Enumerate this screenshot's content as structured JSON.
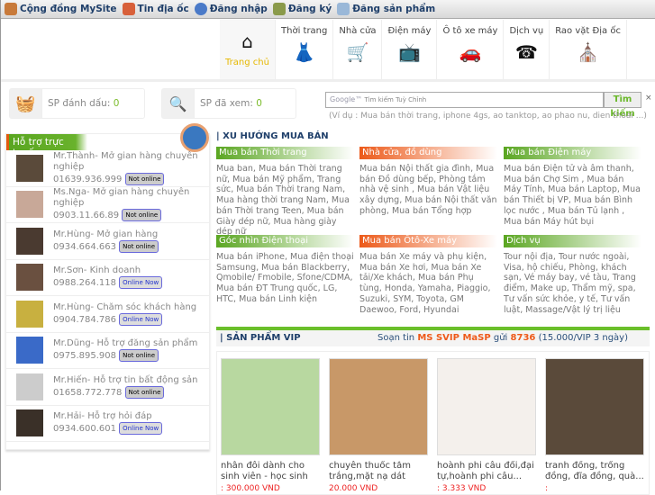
{
  "topbar": {
    "items": [
      {
        "label": "Cộng đồng MySite",
        "icon": "community-icon"
      },
      {
        "label": "Tin địa ốc",
        "icon": "house-icon"
      },
      {
        "label": "Đăng nhập",
        "icon": "login-icon"
      },
      {
        "label": "Đăng ký",
        "icon": "register-icon"
      },
      {
        "label": "Đăng sản phẩm",
        "icon": "post-product-icon"
      }
    ]
  },
  "nav": {
    "home": "Trang chủ",
    "tabs": [
      {
        "label": "Thời trang",
        "glyph": "👗"
      },
      {
        "label": "Nhà cửa",
        "glyph": "🛒"
      },
      {
        "label": "Điện máy",
        "glyph": "📺"
      },
      {
        "label": "Ô tô xe máy",
        "glyph": "🚗"
      },
      {
        "label": "Dịch vụ",
        "glyph": "☎"
      },
      {
        "label": "Rao vặt Địa ốc",
        "glyph": "⛪"
      }
    ]
  },
  "boxes": {
    "marked_label": "SP đánh dấu:",
    "marked_count": "0",
    "viewed_label": "SP đã xem:",
    "viewed_count": "0"
  },
  "support": {
    "title": "Hỗ trợ trực tuyến",
    "people": [
      {
        "name": "Mr.Thành- Mở gian hàng chuyên nghiệp",
        "phone": "01639.936.999",
        "status": "Not online"
      },
      {
        "name": "Ms.Nga- Mở gian hàng chuyên nghiệp",
        "phone": "0903.11.66.89",
        "status": "Not online"
      },
      {
        "name": "Mr.Hùng- Mở gian hàng",
        "phone": "0934.664.663",
        "status": "Not online"
      },
      {
        "name": "Mr.Sơn- Kinh doanh",
        "phone": "0988.264.118",
        "status": "Online Now"
      },
      {
        "name": "Mr.Hùng- Chăm sóc khách hàng",
        "phone": "0904.784.786",
        "status": "Online Now"
      },
      {
        "name": "Mr.Dũng- Hỗ trợ đăng sản phẩm",
        "phone": "0975.895.908",
        "status": "Not online"
      },
      {
        "name": "Mr.Hiến- Hỗ trợ tin bất động sản",
        "phone": "01658.772.778",
        "status": "Not online"
      },
      {
        "name": "Mr.Hải- Hỗ trợ hỏi đáp",
        "phone": "0934.600.601",
        "status": "Online Now"
      }
    ]
  },
  "search": {
    "brand": "Google™",
    "placeholder": "Tìm kiếm Tuỳ Chỉnh",
    "button": "Tìm kiếm",
    "close": "×",
    "hint": "(Ví dụ : Mua bán thời trang, iphone 4gs, ao tanktop, ao phao nu, dien thoai ...)"
  },
  "trends": {
    "title": "| XU HƯỚNG MUA BÁN",
    "cats": [
      {
        "title": "Mua bán Thời trang",
        "body": "Mua ban, Mua bán Thời trang nữ,  Mua bán Mỹ phẩm, Trang sức, Mua bán Thời trang Nam, Mua hàng thời trang Nam, Mua bán Thời trang Teen, Mua bán Giày dép nữ, Mua hàng giày dép nữ"
      },
      {
        "title": "Nhà cửa, đồ dùng",
        "body": "Mua bán Nội thất gia đình, Mua bán Đồ dùng bếp, Phòng tắm nhà vệ sinh , Mua bán Vật liệu xây dựng, Mua bán Nội thất văn phòng, Mua bán Tổng hợp"
      },
      {
        "title": "Mua bán Điện máy",
        "body": "Mua bán Điện tử và âm thanh, Mua bán Chợ Sim , Mua bán Máy Tính, Mua bán Laptop, Mua bán Thiết bị VP, Mua bán Bình lọc nước , Mua bán Tủ lạnh , Mua bán Máy hút bụi"
      },
      {
        "title": "Góc nhìn Điện thoại",
        "body": "Mua bán iPhone, Mua điện thoại Samsung, Mua bán Blackberry, Qmobile/ Fmobile, Sfone/CDMA, Mua bán ĐT Trung quốc, LG, HTC, Mua bán Linh kiện"
      },
      {
        "title": "Mua bán Ôtô-Xe máy",
        "body": "Mua bán Xe máy và phụ kiện, Mua bán Xe hơi, Mua bán Xe tải/Xe khách, Mua bán Phụ tùng, Honda, Yamaha, Piaggio, Suzuki, SYM, Toyota, GM Daewoo, Ford, Hyundai"
      },
      {
        "title": "Dịch vụ",
        "body": "Tour nội địa, Tour nước ngoài, Visa, hộ chiếu, Phòng, khách sạn, Vé máy bay, vé tàu, Trang điểm, Make up, Thẩm mỹ, spa, Tư vấn sức khỏe, y tế, Tư vấn luật, Massage/Vật lý trị liệu"
      }
    ]
  },
  "vip": {
    "title": "| SẢN PHẨM VIP",
    "sms_pre": "Soạn tin",
    "sms_code": "MS SVIP MaSP",
    "sms_mid": "gửi",
    "sms_num": "8736",
    "sms_post": "(15.000/VIP 3 ngày)",
    "products": [
      {
        "name": "nhẫn đôi dành cho sinh viên - học sinh",
        "price": ": 300.000 VND"
      },
      {
        "name": "chuyên thuốc tắm trắng,mặt nạ dát vàng",
        "price": "20.000 VND"
      },
      {
        "name": "hoành phi câu đối,đại tự,hoành phi câu...",
        "price": ": 3.333 VND"
      },
      {
        "name": "tranh đồng, trống đồng, đĩa đồng, quà...",
        "price": ":"
      }
    ]
  }
}
